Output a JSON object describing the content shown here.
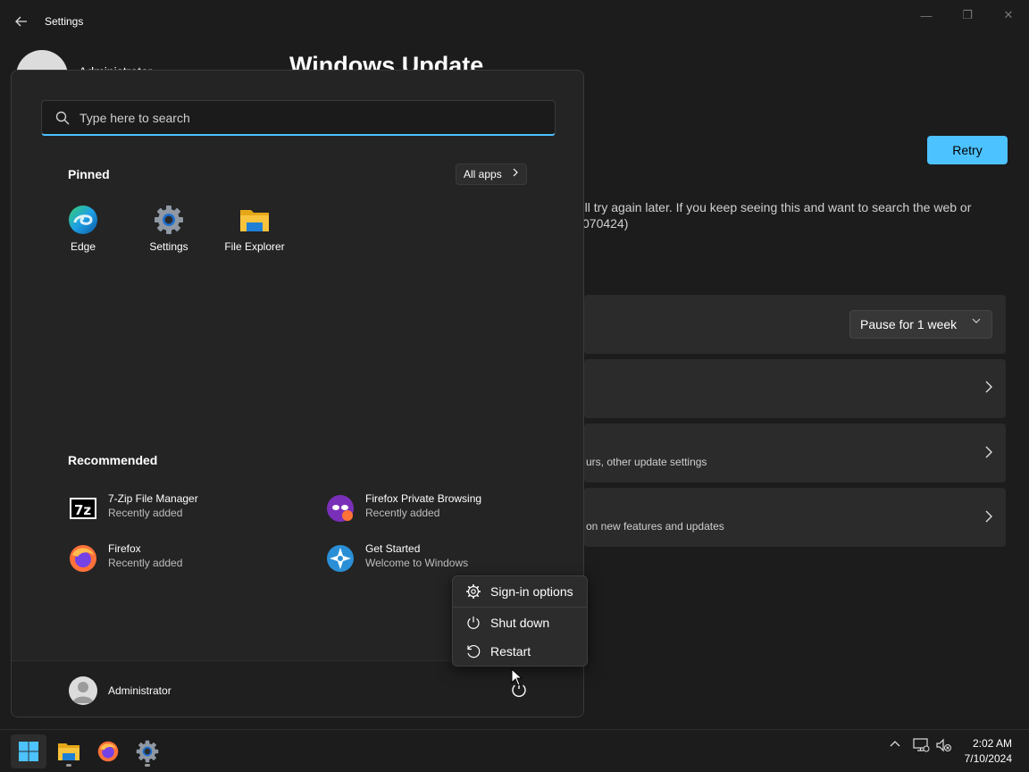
{
  "window": {
    "title": "Settings",
    "account_name": "Administrator",
    "page_title": "Windows Update",
    "minimize_icon": "—",
    "maximize_icon": "❐",
    "close_icon": "✕"
  },
  "update": {
    "retry_label": "Retry",
    "error_line1": "'ll try again later. If you keep seeing this and want to search the web or",
    "error_line2": "070424)",
    "pause_label": "Pause for 1 week",
    "card3_sub": "urs, other update settings",
    "card4_sub": "on new features and updates"
  },
  "start_menu": {
    "search_placeholder": "Type here to search",
    "pinned_title": "Pinned",
    "all_apps_label": "All apps",
    "pinned": [
      {
        "label": "Edge",
        "icon": "edge-icon"
      },
      {
        "label": "Settings",
        "icon": "settings-gear-icon"
      },
      {
        "label": "File Explorer",
        "icon": "folder-icon"
      }
    ],
    "recommended_title": "Recommended",
    "recommended": [
      {
        "name": "7-Zip File Manager",
        "sub": "Recently added",
        "icon": "7zip-icon"
      },
      {
        "name": "Firefox Private Browsing",
        "sub": "Recently added",
        "icon": "firefox-private-icon"
      },
      {
        "name": "Firefox",
        "sub": "Recently added",
        "icon": "firefox-icon"
      },
      {
        "name": "Get Started",
        "sub": "Welcome to Windows",
        "icon": "get-started-icon"
      }
    ],
    "user_name": "Administrator"
  },
  "power_menu": {
    "items": [
      {
        "label": "Sign-in options",
        "icon": "gear-icon"
      },
      {
        "label": "Shut down",
        "icon": "power-icon"
      },
      {
        "label": "Restart",
        "icon": "restart-icon"
      }
    ]
  },
  "taskbar": {
    "time": "2:02 AM",
    "date": "7/10/2024"
  },
  "colors": {
    "accent": "#4cc2ff",
    "background": "#1c1c1c",
    "start_bg": "#242424"
  }
}
